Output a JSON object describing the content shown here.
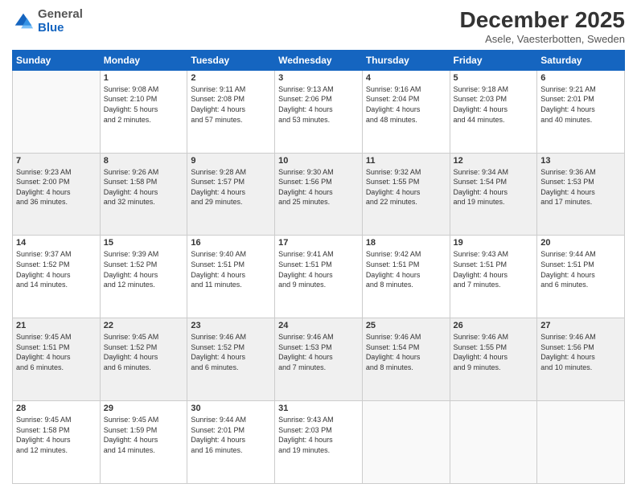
{
  "header": {
    "logo": {
      "general": "General",
      "blue": "Blue"
    },
    "title": "December 2025",
    "subtitle": "Asele, Vaesterbotten, Sweden"
  },
  "calendar": {
    "days_of_week": [
      "Sunday",
      "Monday",
      "Tuesday",
      "Wednesday",
      "Thursday",
      "Friday",
      "Saturday"
    ],
    "rows": [
      {
        "shaded": false,
        "cells": [
          {
            "empty": true,
            "day": "",
            "info": ""
          },
          {
            "empty": false,
            "day": "1",
            "info": "Sunrise: 9:08 AM\nSunset: 2:10 PM\nDaylight: 5 hours\nand 2 minutes."
          },
          {
            "empty": false,
            "day": "2",
            "info": "Sunrise: 9:11 AM\nSunset: 2:08 PM\nDaylight: 4 hours\nand 57 minutes."
          },
          {
            "empty": false,
            "day": "3",
            "info": "Sunrise: 9:13 AM\nSunset: 2:06 PM\nDaylight: 4 hours\nand 53 minutes."
          },
          {
            "empty": false,
            "day": "4",
            "info": "Sunrise: 9:16 AM\nSunset: 2:04 PM\nDaylight: 4 hours\nand 48 minutes."
          },
          {
            "empty": false,
            "day": "5",
            "info": "Sunrise: 9:18 AM\nSunset: 2:03 PM\nDaylight: 4 hours\nand 44 minutes."
          },
          {
            "empty": false,
            "day": "6",
            "info": "Sunrise: 9:21 AM\nSunset: 2:01 PM\nDaylight: 4 hours\nand 40 minutes."
          }
        ]
      },
      {
        "shaded": true,
        "cells": [
          {
            "empty": false,
            "day": "7",
            "info": "Sunrise: 9:23 AM\nSunset: 2:00 PM\nDaylight: 4 hours\nand 36 minutes."
          },
          {
            "empty": false,
            "day": "8",
            "info": "Sunrise: 9:26 AM\nSunset: 1:58 PM\nDaylight: 4 hours\nand 32 minutes."
          },
          {
            "empty": false,
            "day": "9",
            "info": "Sunrise: 9:28 AM\nSunset: 1:57 PM\nDaylight: 4 hours\nand 29 minutes."
          },
          {
            "empty": false,
            "day": "10",
            "info": "Sunrise: 9:30 AM\nSunset: 1:56 PM\nDaylight: 4 hours\nand 25 minutes."
          },
          {
            "empty": false,
            "day": "11",
            "info": "Sunrise: 9:32 AM\nSunset: 1:55 PM\nDaylight: 4 hours\nand 22 minutes."
          },
          {
            "empty": false,
            "day": "12",
            "info": "Sunrise: 9:34 AM\nSunset: 1:54 PM\nDaylight: 4 hours\nand 19 minutes."
          },
          {
            "empty": false,
            "day": "13",
            "info": "Sunrise: 9:36 AM\nSunset: 1:53 PM\nDaylight: 4 hours\nand 17 minutes."
          }
        ]
      },
      {
        "shaded": false,
        "cells": [
          {
            "empty": false,
            "day": "14",
            "info": "Sunrise: 9:37 AM\nSunset: 1:52 PM\nDaylight: 4 hours\nand 14 minutes."
          },
          {
            "empty": false,
            "day": "15",
            "info": "Sunrise: 9:39 AM\nSunset: 1:52 PM\nDaylight: 4 hours\nand 12 minutes."
          },
          {
            "empty": false,
            "day": "16",
            "info": "Sunrise: 9:40 AM\nSunset: 1:51 PM\nDaylight: 4 hours\nand 11 minutes."
          },
          {
            "empty": false,
            "day": "17",
            "info": "Sunrise: 9:41 AM\nSunset: 1:51 PM\nDaylight: 4 hours\nand 9 minutes."
          },
          {
            "empty": false,
            "day": "18",
            "info": "Sunrise: 9:42 AM\nSunset: 1:51 PM\nDaylight: 4 hours\nand 8 minutes."
          },
          {
            "empty": false,
            "day": "19",
            "info": "Sunrise: 9:43 AM\nSunset: 1:51 PM\nDaylight: 4 hours\nand 7 minutes."
          },
          {
            "empty": false,
            "day": "20",
            "info": "Sunrise: 9:44 AM\nSunset: 1:51 PM\nDaylight: 4 hours\nand 6 minutes."
          }
        ]
      },
      {
        "shaded": true,
        "cells": [
          {
            "empty": false,
            "day": "21",
            "info": "Sunrise: 9:45 AM\nSunset: 1:51 PM\nDaylight: 4 hours\nand 6 minutes."
          },
          {
            "empty": false,
            "day": "22",
            "info": "Sunrise: 9:45 AM\nSunset: 1:52 PM\nDaylight: 4 hours\nand 6 minutes."
          },
          {
            "empty": false,
            "day": "23",
            "info": "Sunrise: 9:46 AM\nSunset: 1:52 PM\nDaylight: 4 hours\nand 6 minutes."
          },
          {
            "empty": false,
            "day": "24",
            "info": "Sunrise: 9:46 AM\nSunset: 1:53 PM\nDaylight: 4 hours\nand 7 minutes."
          },
          {
            "empty": false,
            "day": "25",
            "info": "Sunrise: 9:46 AM\nSunset: 1:54 PM\nDaylight: 4 hours\nand 8 minutes."
          },
          {
            "empty": false,
            "day": "26",
            "info": "Sunrise: 9:46 AM\nSunset: 1:55 PM\nDaylight: 4 hours\nand 9 minutes."
          },
          {
            "empty": false,
            "day": "27",
            "info": "Sunrise: 9:46 AM\nSunset: 1:56 PM\nDaylight: 4 hours\nand 10 minutes."
          }
        ]
      },
      {
        "shaded": false,
        "cells": [
          {
            "empty": false,
            "day": "28",
            "info": "Sunrise: 9:45 AM\nSunset: 1:58 PM\nDaylight: 4 hours\nand 12 minutes."
          },
          {
            "empty": false,
            "day": "29",
            "info": "Sunrise: 9:45 AM\nSunset: 1:59 PM\nDaylight: 4 hours\nand 14 minutes."
          },
          {
            "empty": false,
            "day": "30",
            "info": "Sunrise: 9:44 AM\nSunset: 2:01 PM\nDaylight: 4 hours\nand 16 minutes."
          },
          {
            "empty": false,
            "day": "31",
            "info": "Sunrise: 9:43 AM\nSunset: 2:03 PM\nDaylight: 4 hours\nand 19 minutes."
          },
          {
            "empty": true,
            "day": "",
            "info": ""
          },
          {
            "empty": true,
            "day": "",
            "info": ""
          },
          {
            "empty": true,
            "day": "",
            "info": ""
          }
        ]
      }
    ]
  }
}
